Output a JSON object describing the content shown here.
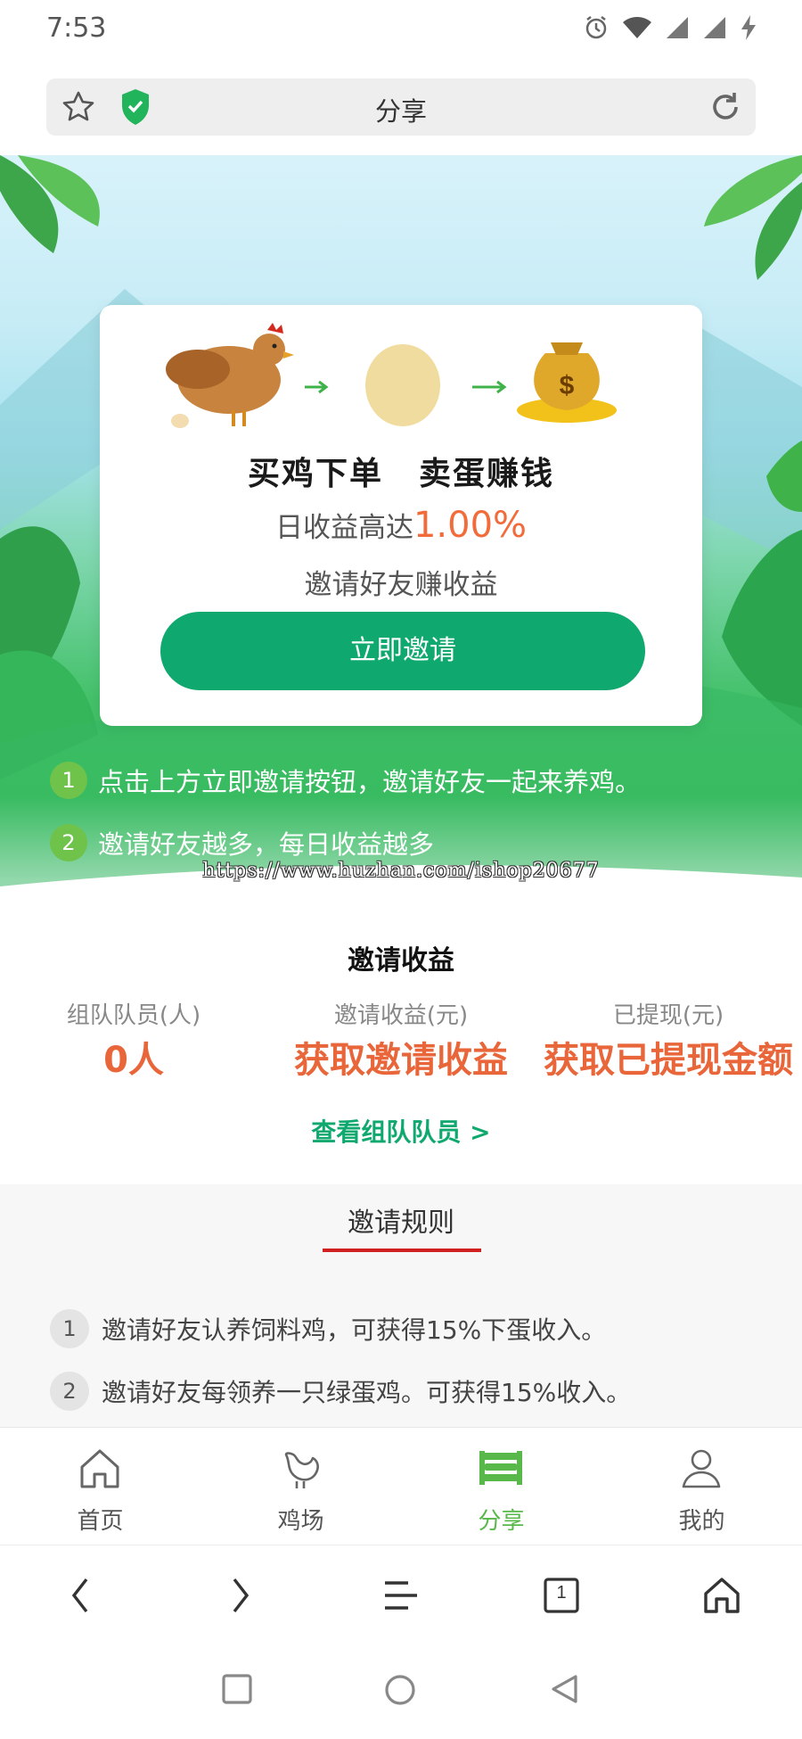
{
  "status_bar": {
    "time": "7:53"
  },
  "browser": {
    "page_title": "分享"
  },
  "hero": {
    "slogan_left": "买鸡下单",
    "slogan_right": "卖蛋赚钱",
    "rate_prefix": "日收益高达",
    "rate_value": "1.00%",
    "subtitle": "邀请好友赚收益",
    "invite_button": "立即邀请",
    "tips": [
      {
        "num": "1",
        "text": "点击上方立即邀请按钮，邀请好友一起来养鸡。"
      },
      {
        "num": "2",
        "text": "邀请好友越多，每日收益越多"
      }
    ],
    "watermark": "https://www.huzhan.com/ishop20677"
  },
  "earnings": {
    "title": "邀请收益",
    "stats": [
      {
        "label": "组队队员(人)",
        "value": "0人"
      },
      {
        "label": "邀请收益(元)",
        "value": "获取邀请收益"
      },
      {
        "label": "已提现(元)",
        "value": "获取已提现金额"
      }
    ],
    "view_team_link": "查看组队队员 >"
  },
  "rules": {
    "tab_label": "邀请规则",
    "items": [
      {
        "num": "1",
        "text": "邀请好友认养饲料鸡，可获得15%下蛋收入。"
      },
      {
        "num": "2",
        "text": "邀请好友每领养一只绿蛋鸡。可获得15%收入。"
      }
    ]
  },
  "bottom_nav": {
    "items": [
      {
        "label": "首页",
        "icon": "home-icon"
      },
      {
        "label": "鸡场",
        "icon": "chicken-icon"
      },
      {
        "label": "分享",
        "icon": "share-icon",
        "active": true
      },
      {
        "label": "我的",
        "icon": "profile-icon"
      }
    ]
  },
  "browser_toolbar": {
    "tab_count": "1"
  },
  "colors": {
    "brand_green": "#0fa86e",
    "accent_orange": "#e8663a",
    "active_nav": "#59b84a",
    "rules_underline": "#d02020"
  }
}
